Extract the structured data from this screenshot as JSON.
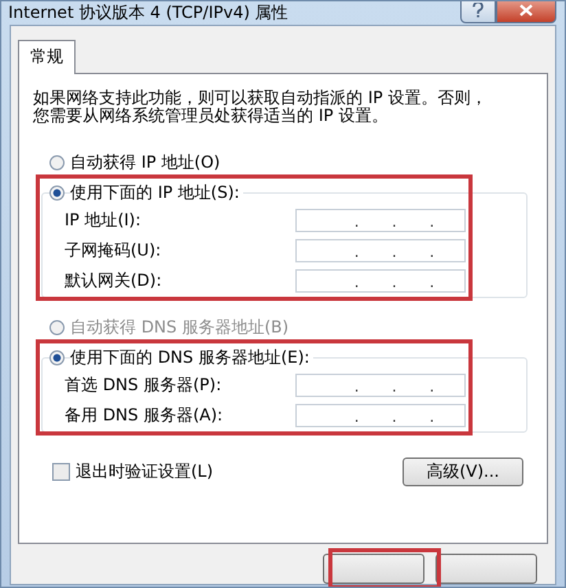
{
  "window": {
    "title": "Internet 协议版本 4 (TCP/IPv4) 属性"
  },
  "tabs": [
    {
      "label": "常规",
      "selected": true
    }
  ],
  "description": "如果网络支持此功能，则可以获取自动指派的 IP 设置。否则，您需要从网络系统管理员处获得适当的 IP 设置。",
  "ip_section": {
    "options": [
      {
        "label": "自动获得 IP 地址(O)",
        "selected": false,
        "disabled": false
      },
      {
        "label": "使用下面的 IP 地址(S):",
        "selected": true,
        "disabled": false
      }
    ],
    "fields": [
      {
        "label": "IP 地址(I):",
        "dots": [
          ".",
          ".",
          "."
        ]
      },
      {
        "label": "子网掩码(U):",
        "dots": [
          ".",
          ".",
          "."
        ]
      },
      {
        "label": "默认网关(D):",
        "dots": [
          ".",
          ".",
          "."
        ]
      }
    ]
  },
  "dns_section": {
    "options": [
      {
        "label": "自动获得 DNS 服务器地址(B)",
        "selected": false,
        "disabled": true
      },
      {
        "label": "使用下面的 DNS 服务器地址(E):",
        "selected": true,
        "disabled": false
      }
    ],
    "fields": [
      {
        "label": "首选 DNS 服务器(P):",
        "dots": [
          ".",
          ".",
          "."
        ]
      },
      {
        "label": "备用 DNS 服务器(A):",
        "dots": [
          ".",
          ".",
          "."
        ]
      }
    ]
  },
  "validate": {
    "label": "退出时验证设置(L)",
    "checked": false
  },
  "advanced_button": "高级(V)..."
}
